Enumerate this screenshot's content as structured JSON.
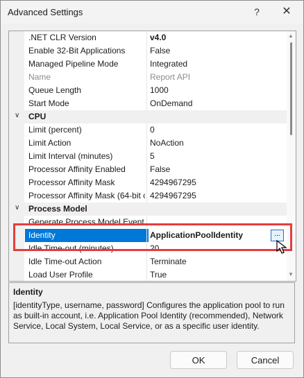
{
  "window": {
    "title": "Advanced Settings",
    "help_glyph": "?",
    "close_glyph": "✕"
  },
  "grid": {
    "rows": [
      {
        "type": "prop",
        "name": ".NET CLR Version",
        "value": "v4.0",
        "bold_value": true
      },
      {
        "type": "prop",
        "name": "Enable 32-Bit Applications",
        "value": "False"
      },
      {
        "type": "prop",
        "name": "Managed Pipeline Mode",
        "value": "Integrated"
      },
      {
        "type": "prop",
        "name": "Name",
        "value": "Report API",
        "disabled": true
      },
      {
        "type": "prop",
        "name": "Queue Length",
        "value": "1000"
      },
      {
        "type": "prop",
        "name": "Start Mode",
        "value": "OnDemand"
      },
      {
        "type": "category",
        "name": "CPU",
        "chevron": "∨"
      },
      {
        "type": "prop",
        "name": "Limit (percent)",
        "value": "0"
      },
      {
        "type": "prop",
        "name": "Limit Action",
        "value": "NoAction"
      },
      {
        "type": "prop",
        "name": "Limit Interval (minutes)",
        "value": "5"
      },
      {
        "type": "prop",
        "name": "Processor Affinity Enabled",
        "value": "False"
      },
      {
        "type": "prop",
        "name": "Processor Affinity Mask",
        "value": "4294967295"
      },
      {
        "type": "prop",
        "name": "Processor Affinity Mask (64-bit o",
        "value": "4294967295"
      },
      {
        "type": "category",
        "name": "Process Model",
        "chevron": "∨"
      },
      {
        "type": "prop",
        "name": "Generate Process Model Event l",
        "value": ""
      },
      {
        "type": "prop",
        "name": "Identity",
        "value": "ApplicationPoolIdentity",
        "selected": true,
        "ellipsis": "..."
      },
      {
        "type": "prop",
        "name": "Idle Time-out (minutes)",
        "value": "20"
      },
      {
        "type": "prop",
        "name": "Idle Time-out Action",
        "value": "Terminate"
      },
      {
        "type": "prop",
        "name": "Load User Profile",
        "value": "True"
      }
    ],
    "scroll_up": "▲",
    "scroll_down": "▼"
  },
  "description": {
    "title": "Identity",
    "text": "[identityType, username, password] Configures the application pool to run as built-in account, i.e. Application Pool Identity (recommended), Network Service, Local System, Local Service, or as a specific user identity."
  },
  "buttons": {
    "ok": "OK",
    "cancel": "Cancel"
  },
  "colors": {
    "selection": "#0078d7",
    "highlight_box": "#e43d3d"
  }
}
